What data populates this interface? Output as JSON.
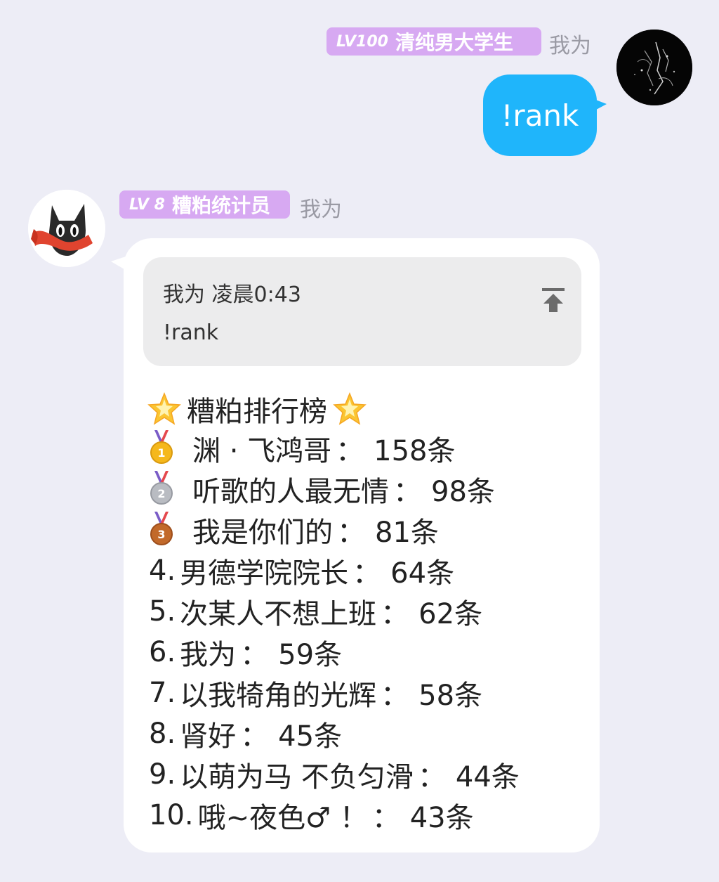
{
  "sent": {
    "badge_level": "LV100",
    "badge_title": "清纯男大学生",
    "nickname": "我为",
    "message": "!rank"
  },
  "reply": {
    "badge_level": "LV 8",
    "badge_title": "糟粕统计员",
    "nickname": "我为",
    "quote": {
      "author": "我为",
      "time": "凌晨0:43",
      "text": "!rank"
    },
    "title": "糟粕排行榜",
    "ranking": [
      {
        "prefix": "",
        "medal": "gold",
        "name": "渊 · 飞鸿哥",
        "count": "158条"
      },
      {
        "prefix": "",
        "medal": "silver",
        "name": "听歌的人最无情",
        "count": "98条"
      },
      {
        "prefix": "",
        "medal": "bronze",
        "name": "我是你们的",
        "count": "81条"
      },
      {
        "prefix": "4.",
        "medal": "",
        "name": "男德学院院长",
        "count": "64条"
      },
      {
        "prefix": "5.",
        "medal": "",
        "name": "次某人不想上班",
        "count": "62条"
      },
      {
        "prefix": "6.",
        "medal": "",
        "name": "我为",
        "count": "59条"
      },
      {
        "prefix": "7.",
        "medal": "",
        "name": "以我犄角的光辉",
        "count": "58条"
      },
      {
        "prefix": "8.",
        "medal": "",
        "name": "肾好",
        "count": "45条"
      },
      {
        "prefix": "9.",
        "medal": "",
        "name": "以萌为马 不负匀滑",
        "count": "44条"
      },
      {
        "prefix": "10.",
        "medal": "",
        "name": "哦~夜色♂ ！",
        "count": "43条"
      }
    ],
    "separator": "："
  },
  "colors": {
    "background": "#ededf6",
    "sent_bubble": "#1fb5fb",
    "badge": "#d7a9f2",
    "nickname": "#9a9aa4"
  },
  "icons": {
    "title_decoration": "glowing-star-icon",
    "quote_action": "jump-to-top-icon",
    "medals": [
      "gold-medal-icon",
      "silver-medal-icon",
      "bronze-medal-icon"
    ]
  }
}
